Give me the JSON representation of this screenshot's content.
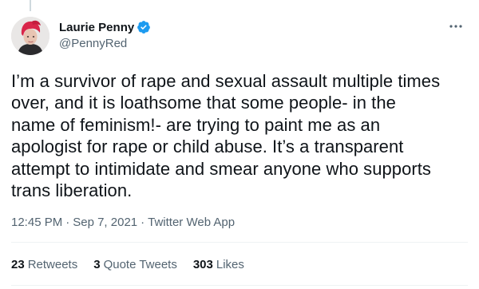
{
  "tweet": {
    "author": {
      "display_name": "Laurie Penny",
      "handle": "@PennyRed"
    },
    "text": "I’m a survivor of rape and sexual assault multiple times\nover, and it is loathsome that some people- in the\nname of feminism!- are trying to paint me as an\napologist for rape or child abuse. It’s a transparent\nattempt to intimidate and smear anyone who supports\ntrans liberation.",
    "meta": {
      "time": "12:45 PM",
      "separator": "·",
      "date": "Sep 7, 2021",
      "source": "Twitter Web App"
    },
    "stats": {
      "retweets_count": "23",
      "retweets_label": "Retweets",
      "quotes_count": "3",
      "quotes_label": "Quote Tweets",
      "likes_count": "303",
      "likes_label": "Likes"
    }
  },
  "icons": {
    "verified": "verified-badge-icon",
    "more": "more-options-icon"
  },
  "colors": {
    "verified_blue": "#1d9bf0",
    "text_primary": "#0f1419",
    "text_secondary": "#536471",
    "divider": "#eff3f4",
    "avatar_hair": "#d9264a"
  }
}
